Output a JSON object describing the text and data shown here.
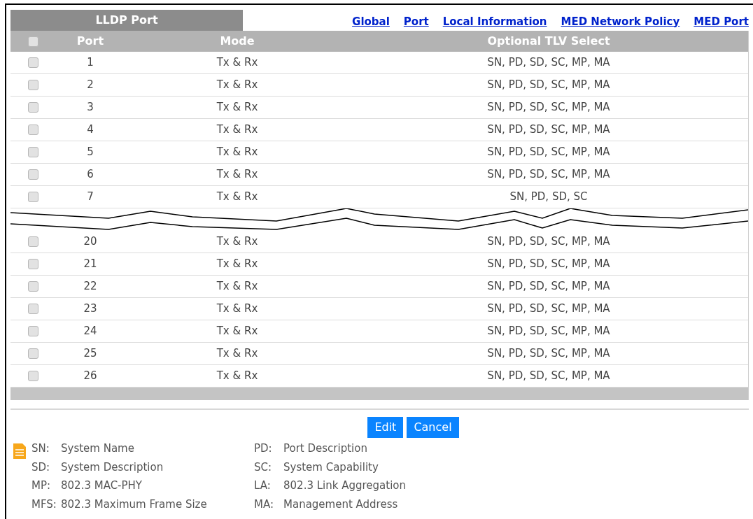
{
  "tab": {
    "label": "LLDP Port",
    "selected": true
  },
  "links": [
    "Global",
    "Port",
    "Local Information",
    "MED Network Policy",
    "MED Port"
  ],
  "table": {
    "select_all": {
      "checked": false
    },
    "columns": [
      "Port",
      "Mode",
      "Optional TLV Select"
    ],
    "rows_before_break": [
      {
        "checked": false,
        "port": "1",
        "mode": "Tx & Rx",
        "tlv": "SN, PD, SD, SC, MP, MA"
      },
      {
        "checked": false,
        "port": "2",
        "mode": "Tx & Rx",
        "tlv": "SN, PD, SD, SC, MP, MA"
      },
      {
        "checked": false,
        "port": "3",
        "mode": "Tx & Rx",
        "tlv": "SN, PD, SD, SC, MP, MA"
      },
      {
        "checked": false,
        "port": "4",
        "mode": "Tx & Rx",
        "tlv": "SN, PD, SD, SC, MP, MA"
      },
      {
        "checked": false,
        "port": "5",
        "mode": "Tx & Rx",
        "tlv": "SN, PD, SD, SC, MP, MA"
      },
      {
        "checked": false,
        "port": "6",
        "mode": "Tx & Rx",
        "tlv": "SN, PD, SD, SC, MP, MA"
      },
      {
        "checked": false,
        "port": "7",
        "mode": "Tx & Rx",
        "tlv": "SN, PD, SD, SC"
      }
    ],
    "rows_after_break": [
      {
        "checked": false,
        "port": "20",
        "mode": "Tx & Rx",
        "tlv": "SN, PD, SD, SC, MP, MA"
      },
      {
        "checked": false,
        "port": "21",
        "mode": "Tx & Rx",
        "tlv": "SN, PD, SD, SC, MP, MA"
      },
      {
        "checked": false,
        "port": "22",
        "mode": "Tx & Rx",
        "tlv": "SN, PD, SD, SC, MP, MA"
      },
      {
        "checked": false,
        "port": "23",
        "mode": "Tx & Rx",
        "tlv": "SN, PD, SD, SC, MP, MA"
      },
      {
        "checked": false,
        "port": "24",
        "mode": "Tx & Rx",
        "tlv": "SN, PD, SD, SC, MP, MA"
      },
      {
        "checked": false,
        "port": "25",
        "mode": "Tx & Rx",
        "tlv": "SN, PD, SD, SC, MP, MA"
      },
      {
        "checked": false,
        "port": "26",
        "mode": "Tx & Rx",
        "tlv": "SN, PD, SD, SC, MP, MA"
      }
    ]
  },
  "buttons": [
    "Edit",
    "Cancel"
  ],
  "legend": [
    {
      "abbr": "SN:",
      "text": "System Name"
    },
    {
      "abbr": "PD:",
      "text": "Port Description"
    },
    {
      "abbr": "SD:",
      "text": "System Description"
    },
    {
      "abbr": "SC:",
      "text": "System Capability"
    },
    {
      "abbr": "MP:",
      "text": "802.3 MAC-PHY"
    },
    {
      "abbr": "LA:",
      "text": "802.3 Link Aggregation"
    },
    {
      "abbr": "MFS:",
      "text": "802.3 Maximum Frame Size"
    },
    {
      "abbr": "MA:",
      "text": "Management Address"
    }
  ]
}
